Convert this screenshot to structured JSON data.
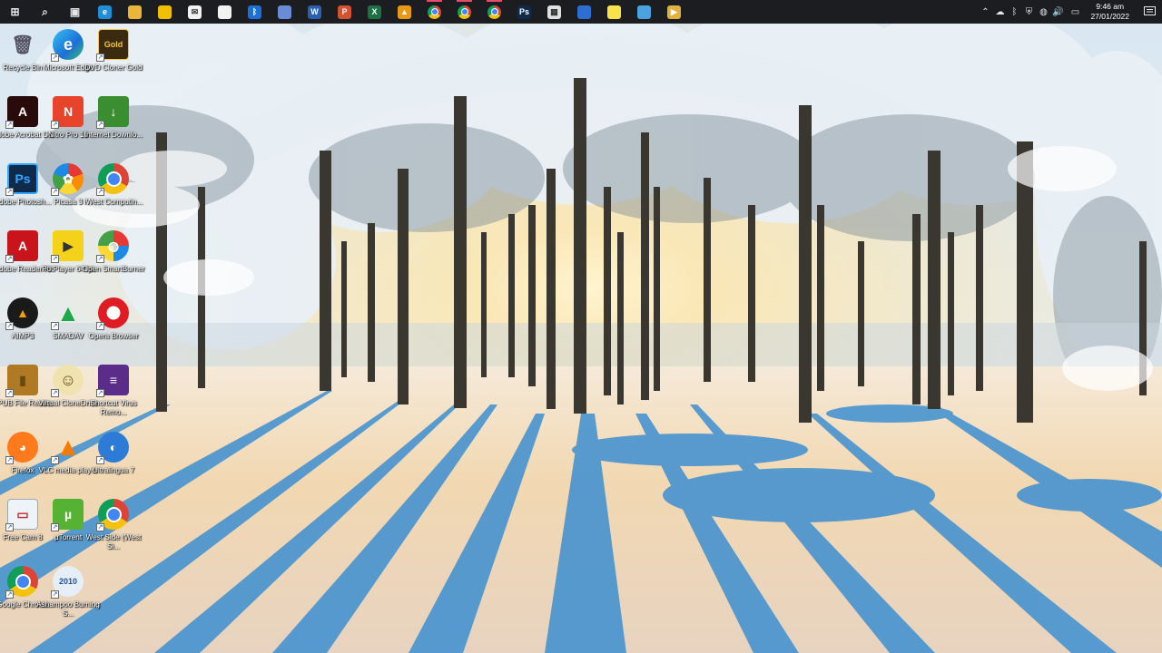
{
  "taskbar": {
    "apps": [
      {
        "name": "start",
        "glyph": "⊞",
        "color": "#1b1d21",
        "active": false
      },
      {
        "name": "search",
        "glyph": "⌕",
        "color": "#1b1d21",
        "active": false
      },
      {
        "name": "task-view",
        "glyph": "▣",
        "color": "#1b1d21",
        "active": false
      },
      {
        "name": "edge",
        "glyph": "e",
        "color": "#1f8fd6",
        "active": false
      },
      {
        "name": "file-explorer",
        "glyph": "",
        "color": "#e8b73a",
        "active": false
      },
      {
        "name": "store",
        "glyph": "",
        "color": "#f0c000",
        "active": false
      },
      {
        "name": "mail",
        "glyph": "✉",
        "color": "#f2f2f2",
        "active": false
      },
      {
        "name": "security",
        "glyph": "",
        "color": "#f2f2f2",
        "active": false
      },
      {
        "name": "bluetooth",
        "glyph": "ᛒ",
        "color": "#1b6fd8",
        "active": false
      },
      {
        "name": "cleaner",
        "glyph": "",
        "color": "#6a8bd6",
        "active": false
      },
      {
        "name": "word",
        "glyph": "W",
        "color": "#2b5fb4",
        "active": false
      },
      {
        "name": "powerpoint",
        "glyph": "P",
        "color": "#d35230",
        "active": false
      },
      {
        "name": "excel",
        "glyph": "X",
        "color": "#1e7145",
        "active": false
      },
      {
        "name": "aimp",
        "glyph": "▲",
        "color": "#e89a16",
        "active": false
      },
      {
        "name": "chrome-1",
        "glyph": "",
        "color": "#db4437",
        "active": true
      },
      {
        "name": "chrome-2",
        "glyph": "",
        "color": "#db4437",
        "active": true
      },
      {
        "name": "chrome-3",
        "glyph": "",
        "color": "#db4437",
        "active": true
      },
      {
        "name": "photoshop",
        "glyph": "Ps",
        "color": "#0f2a4a",
        "active": false
      },
      {
        "name": "calculator",
        "glyph": "▦",
        "color": "#e0e0e0",
        "active": false
      },
      {
        "name": "globe-app",
        "glyph": "",
        "color": "#2c6fd1",
        "active": false
      },
      {
        "name": "sticky-notes",
        "glyph": "",
        "color": "#f8e44a",
        "active": false
      },
      {
        "name": "monitor-app",
        "glyph": "",
        "color": "#4aa3df",
        "active": false
      },
      {
        "name": "media-app",
        "glyph": "▶",
        "color": "#e0b13c",
        "active": false
      }
    ],
    "tray": {
      "time": "9:46 am",
      "date": "27/01/2022"
    }
  },
  "desktop": {
    "icons": [
      {
        "label": "Recycle Bin",
        "icon": "recycle-bin-icon",
        "bg": "#c8d6e4",
        "glyph": "🗑",
        "shortcut": false
      },
      {
        "label": "Microsoft Edge",
        "icon": "edge-icon",
        "bg": "#1f8fd6",
        "glyph": "e",
        "shortcut": true
      },
      {
        "label": "DVD Cloner Gold",
        "icon": "dvd-cloner-icon",
        "bg": "#3a2a10",
        "glyph": "Gold",
        "shortcut": true
      },
      {
        "label": "Adobe Acrobat DC",
        "icon": "acrobat-icon",
        "bg": "#2a0b0b",
        "glyph": "A",
        "shortcut": true
      },
      {
        "label": "Nitro Pro 10",
        "icon": "nitro-icon",
        "bg": "#e8442c",
        "glyph": "N",
        "shortcut": true
      },
      {
        "label": "Internet Downlo...",
        "icon": "idm-icon",
        "bg": "#3b8e2f",
        "glyph": "↓",
        "shortcut": true
      },
      {
        "label": "Adobe Photosh...",
        "icon": "photoshop-icon",
        "bg": "#0f2a4a",
        "glyph": "Ps",
        "shortcut": true
      },
      {
        "label": "Picasa 3",
        "icon": "picasa-icon",
        "bg": "#ffffff",
        "glyph": "✿",
        "shortcut": true
      },
      {
        "label": "iWest Computin...",
        "icon": "chrome-iwest-icon",
        "bg": "#ffffff",
        "glyph": "◉",
        "shortcut": true
      },
      {
        "label": "Adobe Reader XI",
        "icon": "adobe-reader-icon",
        "bg": "#c8141a",
        "glyph": "A",
        "shortcut": true
      },
      {
        "label": "PotPlayer 64 bit",
        "icon": "potplayer-icon",
        "bg": "#f5d21a",
        "glyph": "▶",
        "shortcut": true
      },
      {
        "label": "Open SmartBurner",
        "icon": "smartburner-icon",
        "bg": "#ffffff",
        "glyph": "◍",
        "shortcut": true
      },
      {
        "label": "AIMP3",
        "icon": "aimp-icon",
        "bg": "#1a1a1a",
        "glyph": "▲",
        "shortcut": true
      },
      {
        "label": "SMADAV",
        "icon": "smadav-icon",
        "bg": "#1ba94a",
        "glyph": "▲",
        "shortcut": true
      },
      {
        "label": "Opera Browser",
        "icon": "opera-icon",
        "bg": "#e01b24",
        "glyph": "O",
        "shortcut": true
      },
      {
        "label": "EPUB File Reader",
        "icon": "epub-reader-icon",
        "bg": "#b07a24",
        "glyph": "▮",
        "shortcut": true
      },
      {
        "label": "Virtual CloneDrive",
        "icon": "virtual-clonedrive-icon",
        "bg": "#f1e3b0",
        "glyph": "☺",
        "shortcut": true
      },
      {
        "label": "Shortcut Virus Remo...",
        "icon": "shortcut-virus-remover-icon",
        "bg": "#5b2c8a",
        "glyph": "≡",
        "shortcut": true
      },
      {
        "label": "Firefox",
        "icon": "firefox-icon",
        "bg": "#ff7a1a",
        "glyph": "◕",
        "shortcut": true
      },
      {
        "label": "VLC media player",
        "icon": "vlc-icon",
        "bg": "transparent",
        "glyph": "▲",
        "shortcut": true
      },
      {
        "label": "Ultralingua 7",
        "icon": "ultralingua-icon",
        "bg": "#2c7bd6",
        "glyph": "◐",
        "shortcut": true
      },
      {
        "label": "Free Cam 8",
        "icon": "free-cam-icon",
        "bg": "#eef3f8",
        "glyph": "▭",
        "shortcut": true
      },
      {
        "label": "µTorrent",
        "icon": "utorrent-icon",
        "bg": "#55b233",
        "glyph": "µ",
        "shortcut": true
      },
      {
        "label": "West Side (West Si...",
        "icon": "chrome-westside-icon",
        "bg": "#ffffff",
        "glyph": "◉",
        "shortcut": true
      },
      {
        "label": "Google Chrome",
        "icon": "chrome-icon",
        "bg": "#ffffff",
        "glyph": "◉",
        "shortcut": true
      },
      {
        "label": "Ashampoo Burning S...",
        "icon": "ashampoo-icon",
        "bg": "#e6eef7",
        "glyph": "2010",
        "shortcut": true
      }
    ]
  },
  "colors": {
    "taskbar_bg": "#1b1d21",
    "active_indicator": "#e84b6a",
    "sky": "#dbe9f4",
    "snow": "#f2f0ee",
    "shadow": "#3a8fd0",
    "sun": "#ffd98a"
  }
}
